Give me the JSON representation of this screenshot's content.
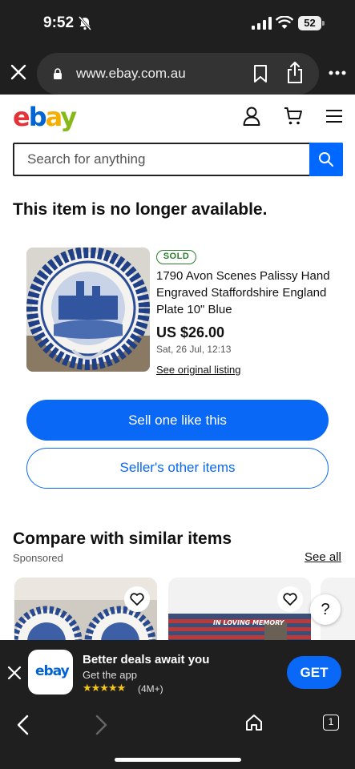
{
  "status_bar": {
    "time": "9:52",
    "battery": "52"
  },
  "browser": {
    "url": "www.ebay.com.au"
  },
  "header": {
    "logo": {
      "e": "e",
      "b": "b",
      "a": "a",
      "y": "y"
    }
  },
  "search": {
    "placeholder": "Search for anything"
  },
  "page": {
    "heading": "This item is no longer available."
  },
  "item": {
    "badge": "SOLD",
    "title": "1790 Avon Scenes Palissy Hand Engraved Staffordshire England Plate 10\" Blue",
    "price": "US $26.00",
    "date": "Sat, 26 Jul, 12:13",
    "original_link": "See original listing"
  },
  "actions": {
    "sell_label": "Sell one like this",
    "seller_items_label": "Seller's other items"
  },
  "similar": {
    "heading": "Compare with similar items",
    "sponsored": "Sponsored",
    "see_all": "See all",
    "card2_banner": "IN LOVING MEMORY"
  },
  "help": {
    "label": "?"
  },
  "promo": {
    "logo_text": "ebay",
    "title": "Better deals await you",
    "subtitle": "Get the app",
    "stars": "★★★★★",
    "rating_count": "(4M+)",
    "cta": "GET"
  },
  "toolbar": {
    "tab_count": "1"
  },
  "colors": {
    "accent": "#0968f6",
    "sold_green": "#2a7d2e",
    "dark_chrome": "#1f1f1f"
  }
}
